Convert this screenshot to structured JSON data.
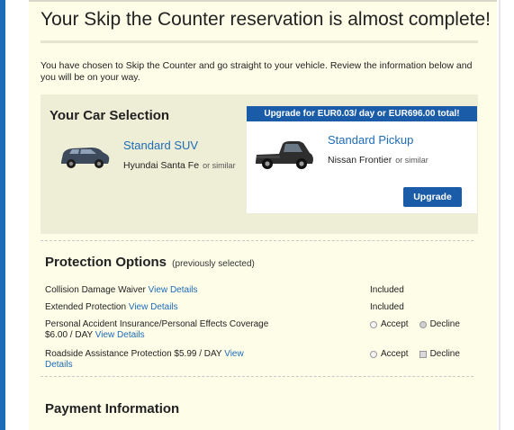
{
  "page": {
    "title": "Your Skip the Counter reservation is almost complete!",
    "intro": "You have chosen to Skip the Counter and go straight to your vehicle. Review the information below and you will be on your way."
  },
  "car_selection": {
    "heading": "Your Car Selection",
    "current": {
      "category": "Standard SUV",
      "model": "Hyundai Santa Fe",
      "similar": "or similar"
    },
    "upgrade": {
      "banner": "Upgrade for EUR0.03/ day or EUR696.00 total!",
      "category": "Standard Pickup",
      "model": "Nissan Frontier",
      "similar": "or similar",
      "button_label": "Upgrade"
    }
  },
  "protection": {
    "heading": "Protection Options",
    "subheading": "(previously selected)",
    "view_details": "View Details",
    "items": [
      {
        "name": "Collision Damage Waiver",
        "status": "Included"
      },
      {
        "name": "Extended Protection",
        "status": "Included"
      },
      {
        "name": "Personal Accident Insurance/Personal Effects Coverage",
        "price": "$6.00 / DAY",
        "accept": "Accept",
        "decline": "Decline"
      },
      {
        "name": "Roadside Assistance Protection $5.99 / DAY",
        "link_part1": "View",
        "link_part2": "Details",
        "accept": "Accept",
        "decline": "Decline"
      }
    ]
  },
  "payment": {
    "heading": "Payment Information"
  },
  "colors": {
    "accent": "#1e6bb8",
    "banner": "#1a5ca8",
    "panel": "#fdfde8",
    "card": "#eeeed6"
  }
}
